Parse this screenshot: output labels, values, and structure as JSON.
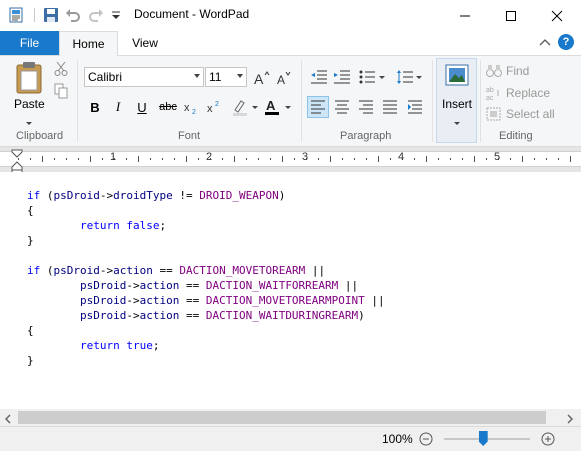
{
  "window": {
    "title": "Document - WordPad"
  },
  "tabs": {
    "file": "File",
    "home": "Home",
    "view": "View"
  },
  "clipboard": {
    "paste": "Paste",
    "label": "Clipboard"
  },
  "font": {
    "family": "Calibri",
    "size": "11",
    "bold": "B",
    "italic": "I",
    "underline": "U",
    "strikethrough": "abc",
    "label": "Font"
  },
  "paragraph": {
    "label": "Paragraph"
  },
  "insert": {
    "label": "Insert"
  },
  "editing": {
    "find": "Find",
    "replace": "Replace",
    "select_all": "Select all",
    "label": "Editing"
  },
  "ruler": {
    "numbers": [
      "1",
      "2",
      "3",
      "4",
      "5"
    ]
  },
  "document": {
    "lines": [
      [
        {
          "t": "if",
          "c": "kw"
        },
        {
          "t": " (",
          "c": "op"
        },
        {
          "t": "psDroid",
          "c": "id"
        },
        {
          "t": "->",
          "c": "op"
        },
        {
          "t": "droidType",
          "c": "id"
        },
        {
          "t": " != ",
          "c": "op"
        },
        {
          "t": "DROID_WEAPON",
          "c": "mac"
        },
        {
          "t": ")",
          "c": "op"
        }
      ],
      [
        {
          "t": "{",
          "c": "op"
        }
      ],
      [
        {
          "t": "        ",
          "c": "op"
        },
        {
          "t": "return",
          "c": "kw"
        },
        {
          "t": " ",
          "c": "op"
        },
        {
          "t": "false",
          "c": "kw"
        },
        {
          "t": ";",
          "c": "op"
        }
      ],
      [
        {
          "t": "}",
          "c": "op"
        }
      ],
      [],
      [
        {
          "t": "if",
          "c": "kw"
        },
        {
          "t": " (",
          "c": "op"
        },
        {
          "t": "psDroid",
          "c": "id"
        },
        {
          "t": "->",
          "c": "op"
        },
        {
          "t": "action",
          "c": "id"
        },
        {
          "t": " == ",
          "c": "op"
        },
        {
          "t": "DACTION_MOVETOREARM",
          "c": "mac"
        },
        {
          "t": " ||",
          "c": "op"
        }
      ],
      [
        {
          "t": "        ",
          "c": "op"
        },
        {
          "t": "psDroid",
          "c": "id"
        },
        {
          "t": "->",
          "c": "op"
        },
        {
          "t": "action",
          "c": "id"
        },
        {
          "t": " == ",
          "c": "op"
        },
        {
          "t": "DACTION_WAITFORREARM",
          "c": "mac"
        },
        {
          "t": " ||",
          "c": "op"
        }
      ],
      [
        {
          "t": "        ",
          "c": "op"
        },
        {
          "t": "psDroid",
          "c": "id"
        },
        {
          "t": "->",
          "c": "op"
        },
        {
          "t": "action",
          "c": "id"
        },
        {
          "t": " == ",
          "c": "op"
        },
        {
          "t": "DACTION_MOVETOREARMPOINT",
          "c": "mac"
        },
        {
          "t": " ||",
          "c": "op"
        }
      ],
      [
        {
          "t": "        ",
          "c": "op"
        },
        {
          "t": "psDroid",
          "c": "id"
        },
        {
          "t": "->",
          "c": "op"
        },
        {
          "t": "action",
          "c": "id"
        },
        {
          "t": " == ",
          "c": "op"
        },
        {
          "t": "DACTION_WAITDURINGREARM",
          "c": "mac"
        },
        {
          "t": ")",
          "c": "op"
        }
      ],
      [
        {
          "t": "{",
          "c": "op"
        }
      ],
      [
        {
          "t": "        ",
          "c": "op"
        },
        {
          "t": "return",
          "c": "kw"
        },
        {
          "t": " ",
          "c": "op"
        },
        {
          "t": "true",
          "c": "kw"
        },
        {
          "t": ";",
          "c": "op"
        }
      ],
      [
        {
          "t": "}",
          "c": "op"
        }
      ]
    ]
  },
  "status": {
    "zoom": "100%",
    "zoom_level": 0.45
  },
  "colors": {
    "accent": "#1979ca",
    "keyword": "#0000ff",
    "identifier": "#000080",
    "macro": "#800080"
  }
}
